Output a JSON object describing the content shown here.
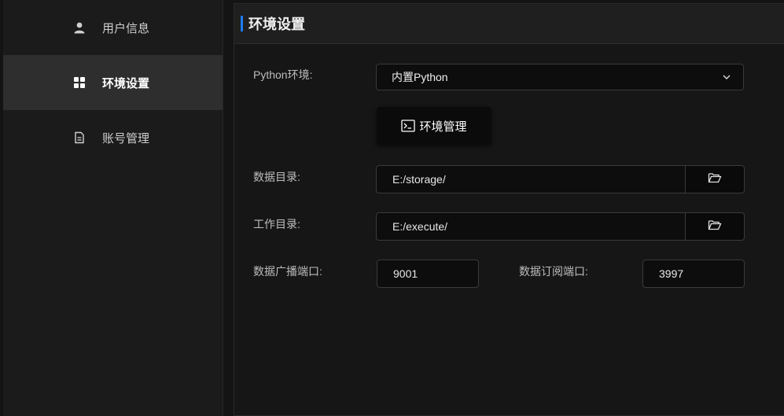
{
  "sidebar": {
    "items": [
      {
        "label": "用户信息",
        "icon": "user-icon",
        "active": false
      },
      {
        "label": "环境设置",
        "icon": "grid-icon",
        "active": true
      },
      {
        "label": "账号管理",
        "icon": "document-icon",
        "active": false
      }
    ]
  },
  "panel": {
    "title": "环境设置",
    "accent_color": "#1e7cf0"
  },
  "form": {
    "python_env": {
      "label": "Python环境:",
      "selected": "内置Python"
    },
    "env_manage_button": {
      "label": "环境管理",
      "icon": "terminal-icon"
    },
    "data_dir": {
      "label": "数据目录:",
      "value": "E:/storage/",
      "browse_icon": "folder-icon"
    },
    "work_dir": {
      "label": "工作目录:",
      "value": "E:/execute/",
      "browse_icon": "folder-icon"
    },
    "broadcast_port": {
      "label": "数据广播端口:",
      "value": "9001"
    },
    "subscribe_port": {
      "label": "数据订阅端口:",
      "value": "3997"
    }
  }
}
